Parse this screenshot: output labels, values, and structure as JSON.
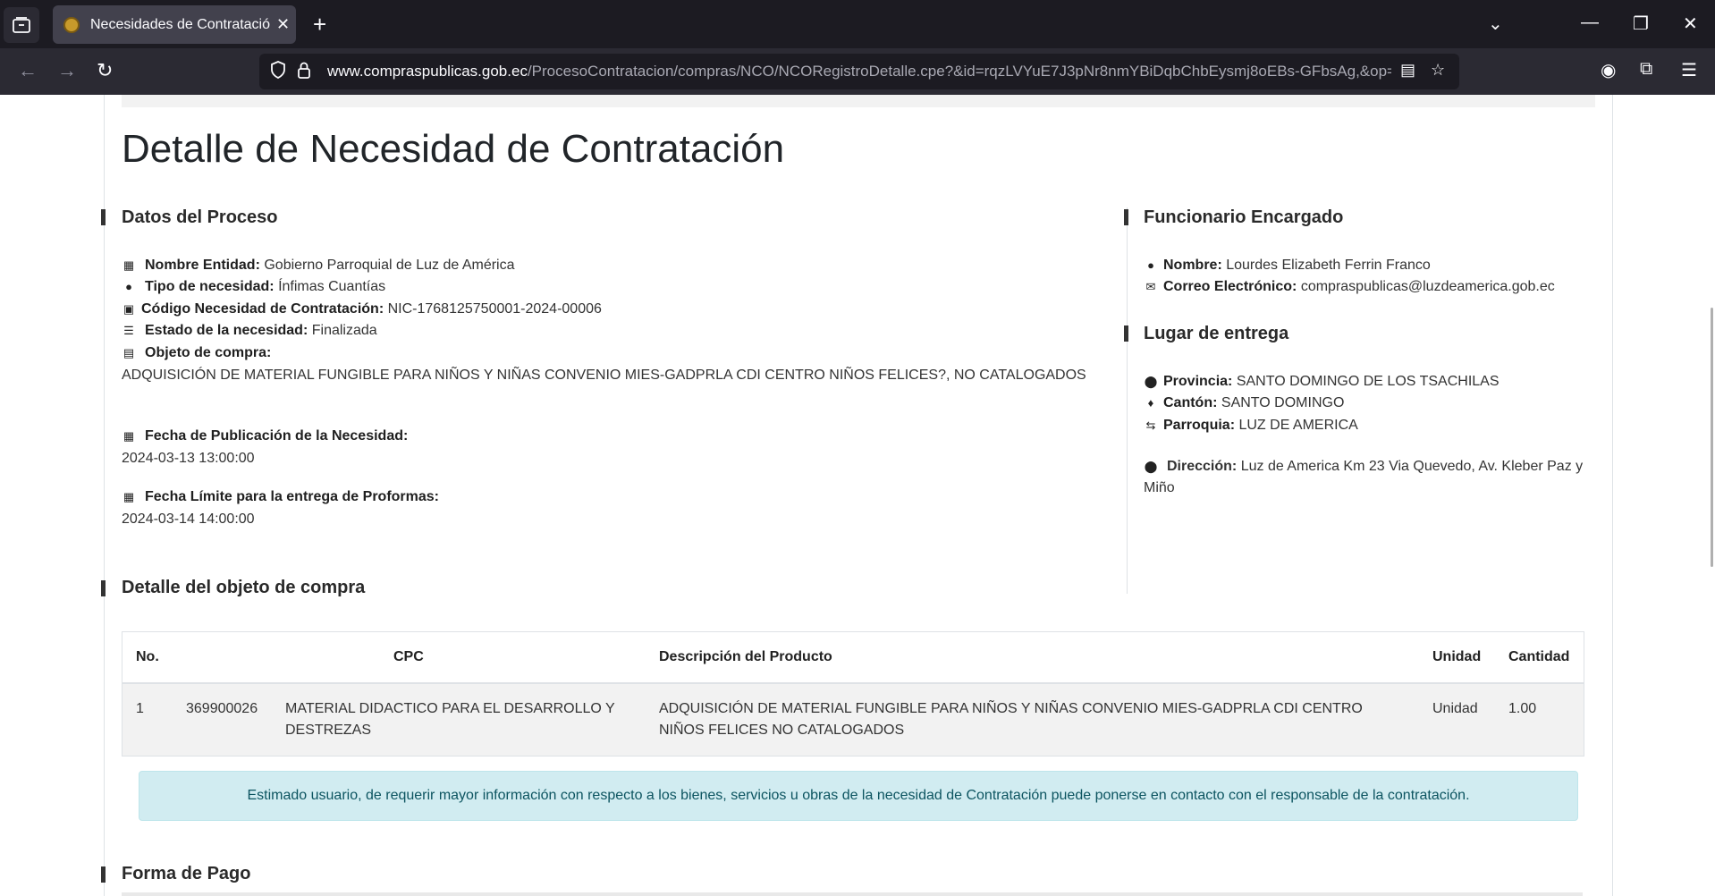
{
  "browser": {
    "tab_title": "Necesidades de Contratación y",
    "url_domain": "www.compraspublicas.gob.ec",
    "url_path": "/ProcesoContratacion/compras/NCO/NCORegistroDetalle.cpe?&id=rqzLVYuE7J3pNr8nmYBiDqbChbEysmj8oEBs-GFbsAg,&op="
  },
  "page": {
    "title": "Detalle de Necesidad de Contratación"
  },
  "proceso": {
    "heading": "Datos del Proceso",
    "nombre_entidad_label": "Nombre Entidad:",
    "nombre_entidad": "Gobierno Parroquial de Luz de América",
    "tipo_label": "Tipo de necesidad:",
    "tipo": "Ínfimas Cuantías",
    "codigo_label": "Código Necesidad de Contratación:",
    "codigo": "NIC-1768125750001-2024-00006",
    "estado_label": "Estado de la necesidad:",
    "estado": "Finalizada",
    "objeto_label": "Objeto de compra:",
    "objeto": "ADQUISICIÓN DE MATERIAL FUNGIBLE PARA NIÑOS Y NIÑAS CONVENIO MIES-GADPRLA CDI CENTRO NIÑOS FELICES?, NO CATALOGADOS",
    "fecha_pub_label": "Fecha de Publicación de la Necesidad:",
    "fecha_pub": "2024-03-13 13:00:00",
    "fecha_limite_label": "Fecha Límite para la entrega de Proformas:",
    "fecha_limite": "2024-03-14 14:00:00"
  },
  "funcionario": {
    "heading": "Funcionario Encargado",
    "nombre_label": "Nombre:",
    "nombre": "Lourdes Elizabeth Ferrin Franco",
    "correo_label": "Correo Electrónico:",
    "correo": "compraspublicas@luzdeamerica.gob.ec"
  },
  "lugar": {
    "heading": "Lugar de entrega",
    "provincia_label": "Provincia:",
    "provincia": "SANTO DOMINGO DE LOS TSACHILAS",
    "canton_label": "Cantón:",
    "canton": "SANTO DOMINGO",
    "parroquia_label": "Parroquia:",
    "parroquia": "LUZ DE AMERICA",
    "direccion_label": "Dirección:",
    "direccion": "Luz de America Km 23 Via Quevedo, Av. Kleber Paz y Miño"
  },
  "detalle": {
    "heading": "Detalle del objeto de compra",
    "headers": {
      "no": "No.",
      "cpc": "CPC",
      "descripcion": "Descripción del Producto",
      "unidad": "Unidad",
      "cantidad": "Cantidad"
    },
    "rows": [
      {
        "no": "1",
        "cpc_code": "369900026",
        "cpc_desc": "MATERIAL DIDACTICO PARA EL DESARROLLO Y DESTREZAS",
        "descripcion": "ADQUISICIÓN DE MATERIAL FUNGIBLE PARA NIÑOS Y NIÑAS CONVENIO MIES-GADPRLA CDI CENTRO NIÑOS FELICES NO CATALOGADOS",
        "unidad": "Unidad",
        "cantidad": "1.00"
      }
    ]
  },
  "alert": "Estimado usuario, de requerir mayor información con respecto a los bienes, servicios u obras de la necesidad de Contratación puede ponerse en contacto con el responsable de la contratación.",
  "forma_pago": {
    "heading": "Forma de Pago"
  }
}
